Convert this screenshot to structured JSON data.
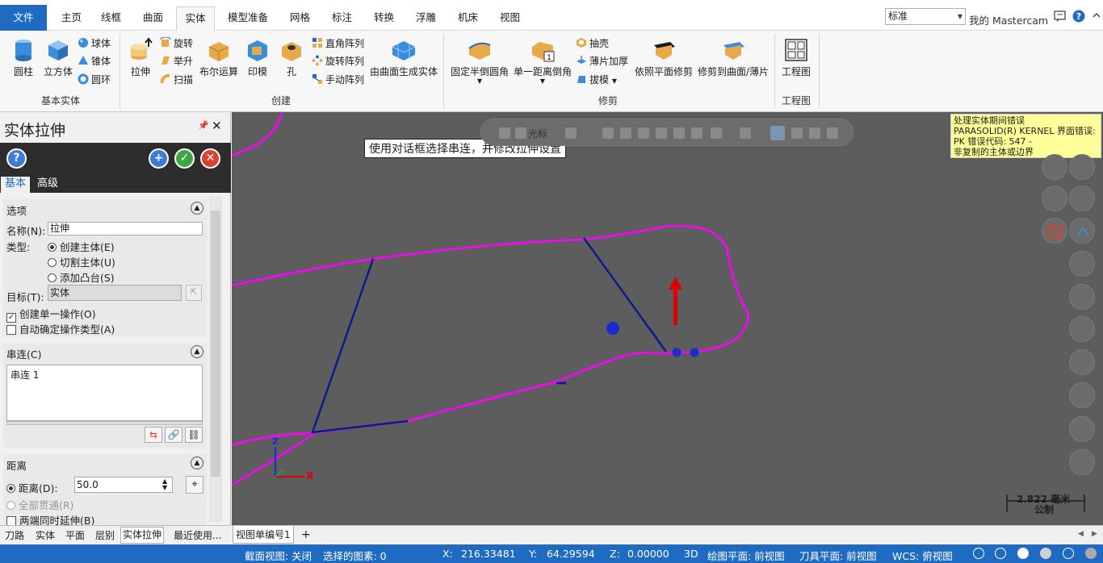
{
  "ribbon_tabs": [
    "文件",
    "主页",
    "线框",
    "曲面",
    "实体",
    "模型准备",
    "网格",
    "标注",
    "转换",
    "浮雕",
    "机床",
    "视图"
  ],
  "active_tab": "实体",
  "style_select": "标准",
  "my_mastercam": "我的 Mastercam",
  "groups": {
    "basic_solid": {
      "label": "基本实体",
      "cylinder": "圆柱",
      "cube": "立方体",
      "sphere": "球体",
      "cone": "锥体",
      "torus": "圆环"
    },
    "create": {
      "label": "创建",
      "extrude": "拉伸",
      "revolve": "旋转",
      "loft": "举升",
      "sweep": "扫描",
      "boolean": "布尔运算",
      "imprint": "印模",
      "hole": "孔",
      "rect_array": "直角阵列",
      "rotate_array": "旋转阵列",
      "manual_array": "手动阵列",
      "from_surfaces": "由曲面生成实体"
    },
    "modify": {
      "label": "修剪",
      "fixed_fillet": "固定半倒圆角",
      "chamfer": "单一距离倒角",
      "shell": "抽壳",
      "thicken": "薄片加厚",
      "draft": "拔模",
      "trim_plane": "依照平面修剪",
      "trim_surface": "修剪到曲面/薄片"
    },
    "drawing": {
      "label": "工程图",
      "layout": "工程图"
    }
  },
  "panel": {
    "title": "实体拉伸",
    "tabs": {
      "basic": "基本",
      "advanced": "高级"
    },
    "options": {
      "header": "选项",
      "name_label": "名称(N):",
      "name_value": "拉伸",
      "type_label": "类型:",
      "type_create": "创建主体(E)",
      "type_cut": "切割主体(U)",
      "type_add": "添加凸台(S)",
      "target_label": "目标(T):",
      "target_value": "实体",
      "create_single": "创建单一操作(O)",
      "auto_type": "自动确定操作类型(A)"
    },
    "chain": {
      "header": "串连(C)",
      "items": [
        "串连 1"
      ]
    },
    "distance": {
      "header": "距离",
      "distance_label": "距离(D):",
      "distance_value": "50.0",
      "through_all": "全部贯通(R)",
      "both_dirs": "两端同时延伸(B)"
    }
  },
  "bottom_tabs": [
    "刀路",
    "实体",
    "平面",
    "层别",
    "实体拉伸",
    "最近使用..."
  ],
  "active_bottom_tab": "实体拉伸",
  "viewport": {
    "hint": "使用对话框选择串连，并修改拉伸设置",
    "hud_selection": "光标",
    "error_lines": [
      "处理实体期间错误",
      "PARASOLID(R) KERNEL 界面错误:",
      "PK 错误代码: 547 -",
      "非复制的主体或边界"
    ],
    "axis_z": "Z",
    "axis_x": "X",
    "scale_value": "2.822 毫米",
    "scale_unit": "公制"
  },
  "view_tabs": {
    "tab1": "视图单编号1",
    "add": "+"
  },
  "status": {
    "section_view": "截面视图: 关闭",
    "selected": "选择的图素: 0",
    "x_label": "X:",
    "x_value": "216.33481",
    "y_label": "Y:",
    "y_value": "64.29594",
    "z_label": "Z:",
    "z_value": "0.00000",
    "mode": "3D",
    "cplane": "绘图平面: 前视图",
    "tplane": "刀具平面: 前视图",
    "wcs": "WCS: 俯视图"
  },
  "colors": {
    "accent": "#1f6bc2",
    "viewport_bg": "#5d5d5d",
    "chain_magenta": "#ff00ff",
    "geometry_blue": "#0b1a8c",
    "arrow_red": "#dd0000",
    "error_bg": "#ffff99"
  }
}
